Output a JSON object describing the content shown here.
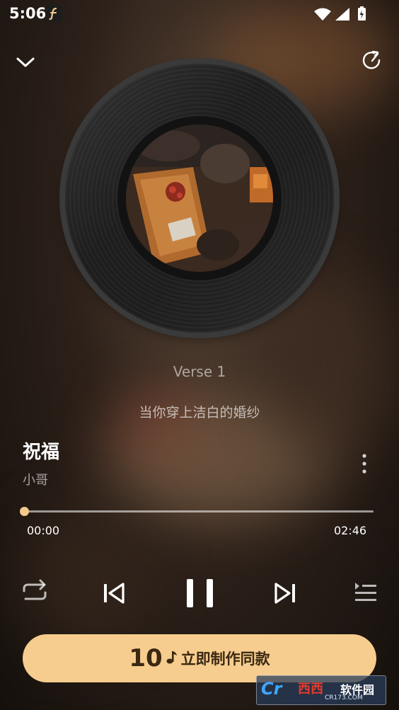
{
  "status_bar": {
    "time": "5:06",
    "app_icon": "music-f-icon",
    "icons": [
      "wifi-icon",
      "signal-icon",
      "battery-charging-icon"
    ]
  },
  "header": {
    "collapse_icon": "chevron-down-icon",
    "share_icon": "share-icon"
  },
  "player": {
    "section_label": "Verse 1",
    "lyric_line": "当你穿上洁白的婚纱",
    "title": "祝福",
    "artist": "小哥",
    "more_icon": "more-vertical-icon",
    "time_current": "00:00",
    "time_total": "02:46",
    "progress": 0.0
  },
  "controls": {
    "repeat_icon": "repeat-icon",
    "prev_icon": "skip-previous-icon",
    "play_state_icon": "pause-icon",
    "next_icon": "skip-next-icon",
    "playlist_icon": "playlist-icon"
  },
  "cta": {
    "count": "10",
    "note_icon": "music-note-icon",
    "label": "立即制作同款"
  },
  "watermark": {
    "logo": "Cr",
    "text": "西西",
    "sub": "软件园",
    "url": "CR173.COM"
  },
  "colors": {
    "accent": "#f6cd8e",
    "progress": "#f4c98b",
    "cta_text": "#3b2812"
  }
}
